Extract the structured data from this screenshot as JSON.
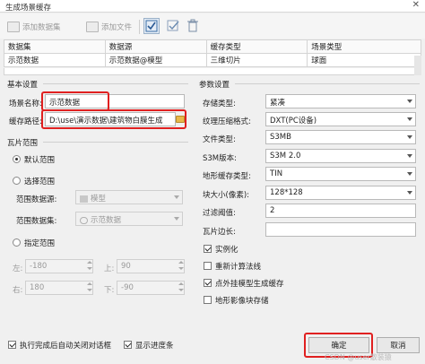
{
  "window": {
    "title": "生成场景缓存",
    "close_glyph": "✕"
  },
  "toolbar": {
    "add_dataset": "添加数据集",
    "add_file": "添加文件"
  },
  "table": {
    "headers": [
      "数据集",
      "数据源",
      "缓存类型",
      "场景类型"
    ],
    "rows": [
      [
        "示范数据",
        "示范数据@模型",
        "三维切片",
        "球面"
      ]
    ]
  },
  "basic": {
    "section": "基本设置",
    "scene_name_label": "场景名称:",
    "scene_name_value": "示范数据",
    "cache_path_label": "缓存路径:",
    "cache_path_value": "D:\\use\\演示数据\\建筑物白膜生成"
  },
  "tile_range": {
    "section": "瓦片范围",
    "default_range": "默认范围",
    "select_range": "选择范围",
    "range_datasource_label": "范围数据源:",
    "range_datasource_value": "模型",
    "range_dataset_label": "范围数据集:",
    "range_dataset_value": "示范数据",
    "specify_range": "指定范围",
    "left_label": "左:",
    "left_value": "-180",
    "top_label": "上:",
    "top_value": "90",
    "right_label": "右:",
    "right_value": "180",
    "bottom_label": "下:",
    "bottom_value": "-90"
  },
  "params": {
    "section": "参数设置",
    "storage_type_label": "存储类型:",
    "storage_type_value": "紧凑",
    "texture_format_label": "纹理压缩格式:",
    "texture_format_value": "DXT(PC设备)",
    "file_type_label": "文件类型:",
    "file_type_value": "S3MB",
    "s3m_version_label": "S3M版本:",
    "s3m_version_value": "S3M 2.0",
    "terrain_cache_label": "地形缓存类型:",
    "terrain_cache_value": "TIN",
    "block_size_label": "块大小(像素):",
    "block_size_value": "128*128",
    "filter_threshold_label": "过滤阈值:",
    "filter_threshold_value": "2",
    "tile_side_label": "瓦片边长:",
    "tile_side_value": "",
    "instancing": "实例化",
    "recompute_normals": "重新计算法线",
    "point_external_model": "点外挂模型生成缓存",
    "terrain_image_block": "地形影像块存储"
  },
  "footer": {
    "auto_close": "执行完成后自动关闭对话框",
    "show_progress": "显示进度条",
    "ok": "确定",
    "cancel": "取消"
  },
  "watermark": "CSDN @user散装猿"
}
